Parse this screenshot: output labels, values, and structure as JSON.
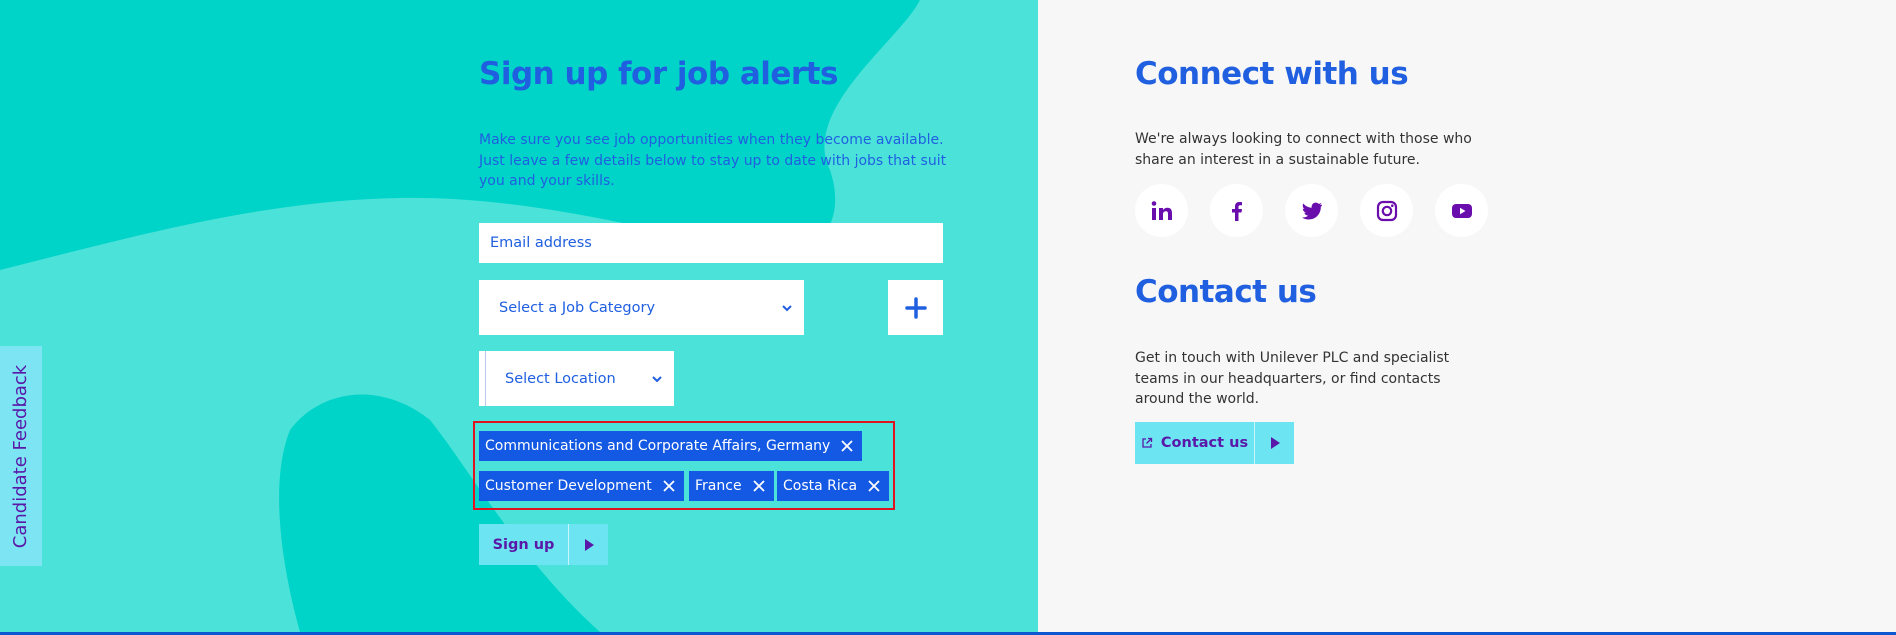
{
  "signup": {
    "title": "Sign up for job alerts",
    "description": "Make sure you see job opportunities when they become available. Just leave a few details below to stay up to date with jobs that suit you and your skills.",
    "email_placeholder": "Email address",
    "category_select": "Select a Job Category",
    "location_select": "Select Location",
    "add_icon": "plus-icon",
    "chips": [
      {
        "label": "Communications and Corporate Affairs, Germany"
      },
      {
        "label": "Customer Development"
      },
      {
        "label": "France"
      },
      {
        "label": "Costa Rica"
      }
    ],
    "button_label": "Sign up"
  },
  "feedback": {
    "label": "Candidate Feedback"
  },
  "connect": {
    "title": "Connect with us",
    "description": "We're always looking to connect with those who share an interest in a sustainable future.",
    "socials": [
      "linkedin-icon",
      "facebook-icon",
      "twitter-icon",
      "instagram-icon",
      "youtube-icon"
    ]
  },
  "contact": {
    "title": "Contact us",
    "description": "Get in touch with Unilever PLC and specialist teams in our headquarters, or find contacts around the world.",
    "button_label": "Contact us"
  },
  "colors": {
    "teal": "#00d4c8",
    "teal_light": "#4be3d9",
    "brand_blue": "#1f5fe0",
    "chip_blue": "#1459e3",
    "button_cyan": "#6de4f2",
    "purple": "#5a18a8",
    "highlight_red": "#e0141e"
  }
}
